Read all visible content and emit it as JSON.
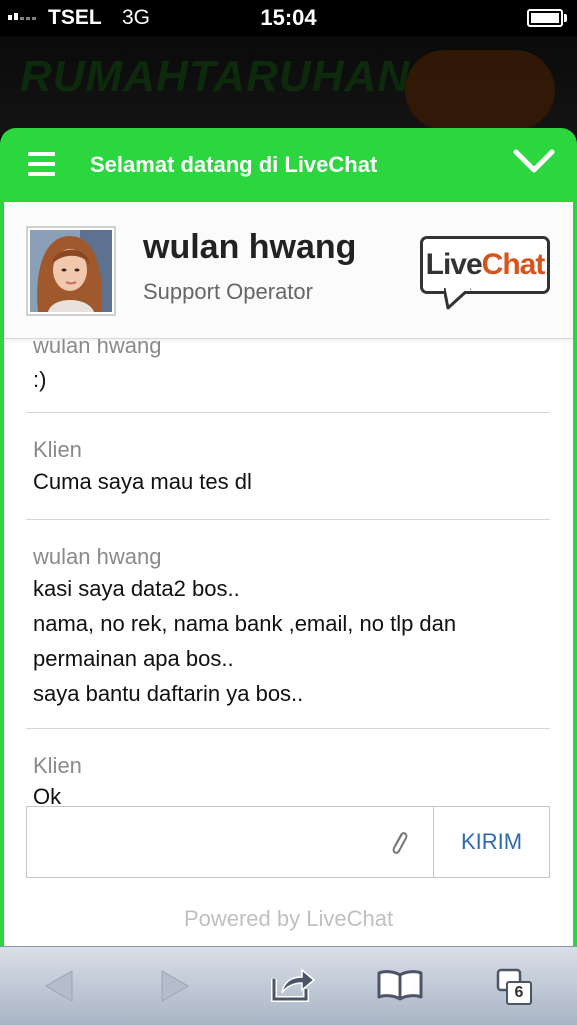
{
  "status_bar": {
    "carrier": "TSEL",
    "network": "3G",
    "time": "15:04"
  },
  "website": {
    "title": "RUMAHTARUHAN"
  },
  "widget": {
    "header_title": "Selamat datang di LiveChat",
    "operator": {
      "name": "wulan hwang",
      "role": "Support Operator"
    },
    "brand": {
      "live": "Live",
      "chat": "Chat"
    },
    "messages": [
      {
        "author": "wulan hwang",
        "lines": [
          ":)"
        ]
      },
      {
        "author": "Klien",
        "lines": [
          "Cuma saya mau tes dl"
        ]
      },
      {
        "author": "wulan hwang",
        "lines": [
          "kasi saya data2 bos..",
          "nama, no rek, nama bank ,email, no tlp dan",
          "permainan apa bos..",
          "saya bantu daftarin ya bos.."
        ]
      },
      {
        "author": "Klien",
        "lines": [
          "Ok"
        ]
      }
    ],
    "input_placeholder": "",
    "send_label": "KIRIM",
    "powered_by": "Powered by LiveChat"
  },
  "toolbar": {
    "tab_count": "6"
  },
  "colors": {
    "header_green": "#2bd63f",
    "send_blue": "#2d6ab0",
    "brand_orange": "#d9541a"
  }
}
